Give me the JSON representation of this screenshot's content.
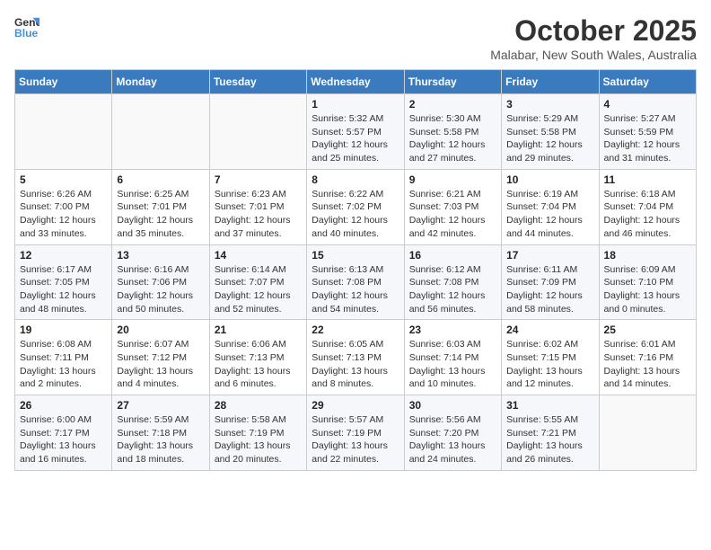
{
  "header": {
    "logo_line1": "General",
    "logo_line2": "Blue",
    "month": "October 2025",
    "location": "Malabar, New South Wales, Australia"
  },
  "weekdays": [
    "Sunday",
    "Monday",
    "Tuesday",
    "Wednesday",
    "Thursday",
    "Friday",
    "Saturday"
  ],
  "weeks": [
    [
      {
        "day": "",
        "text": ""
      },
      {
        "day": "",
        "text": ""
      },
      {
        "day": "",
        "text": ""
      },
      {
        "day": "1",
        "text": "Sunrise: 5:32 AM\nSunset: 5:57 PM\nDaylight: 12 hours\nand 25 minutes."
      },
      {
        "day": "2",
        "text": "Sunrise: 5:30 AM\nSunset: 5:58 PM\nDaylight: 12 hours\nand 27 minutes."
      },
      {
        "day": "3",
        "text": "Sunrise: 5:29 AM\nSunset: 5:58 PM\nDaylight: 12 hours\nand 29 minutes."
      },
      {
        "day": "4",
        "text": "Sunrise: 5:27 AM\nSunset: 5:59 PM\nDaylight: 12 hours\nand 31 minutes."
      }
    ],
    [
      {
        "day": "5",
        "text": "Sunrise: 6:26 AM\nSunset: 7:00 PM\nDaylight: 12 hours\nand 33 minutes."
      },
      {
        "day": "6",
        "text": "Sunrise: 6:25 AM\nSunset: 7:01 PM\nDaylight: 12 hours\nand 35 minutes."
      },
      {
        "day": "7",
        "text": "Sunrise: 6:23 AM\nSunset: 7:01 PM\nDaylight: 12 hours\nand 37 minutes."
      },
      {
        "day": "8",
        "text": "Sunrise: 6:22 AM\nSunset: 7:02 PM\nDaylight: 12 hours\nand 40 minutes."
      },
      {
        "day": "9",
        "text": "Sunrise: 6:21 AM\nSunset: 7:03 PM\nDaylight: 12 hours\nand 42 minutes."
      },
      {
        "day": "10",
        "text": "Sunrise: 6:19 AM\nSunset: 7:04 PM\nDaylight: 12 hours\nand 44 minutes."
      },
      {
        "day": "11",
        "text": "Sunrise: 6:18 AM\nSunset: 7:04 PM\nDaylight: 12 hours\nand 46 minutes."
      }
    ],
    [
      {
        "day": "12",
        "text": "Sunrise: 6:17 AM\nSunset: 7:05 PM\nDaylight: 12 hours\nand 48 minutes."
      },
      {
        "day": "13",
        "text": "Sunrise: 6:16 AM\nSunset: 7:06 PM\nDaylight: 12 hours\nand 50 minutes."
      },
      {
        "day": "14",
        "text": "Sunrise: 6:14 AM\nSunset: 7:07 PM\nDaylight: 12 hours\nand 52 minutes."
      },
      {
        "day": "15",
        "text": "Sunrise: 6:13 AM\nSunset: 7:08 PM\nDaylight: 12 hours\nand 54 minutes."
      },
      {
        "day": "16",
        "text": "Sunrise: 6:12 AM\nSunset: 7:08 PM\nDaylight: 12 hours\nand 56 minutes."
      },
      {
        "day": "17",
        "text": "Sunrise: 6:11 AM\nSunset: 7:09 PM\nDaylight: 12 hours\nand 58 minutes."
      },
      {
        "day": "18",
        "text": "Sunrise: 6:09 AM\nSunset: 7:10 PM\nDaylight: 13 hours\nand 0 minutes."
      }
    ],
    [
      {
        "day": "19",
        "text": "Sunrise: 6:08 AM\nSunset: 7:11 PM\nDaylight: 13 hours\nand 2 minutes."
      },
      {
        "day": "20",
        "text": "Sunrise: 6:07 AM\nSunset: 7:12 PM\nDaylight: 13 hours\nand 4 minutes."
      },
      {
        "day": "21",
        "text": "Sunrise: 6:06 AM\nSunset: 7:13 PM\nDaylight: 13 hours\nand 6 minutes."
      },
      {
        "day": "22",
        "text": "Sunrise: 6:05 AM\nSunset: 7:13 PM\nDaylight: 13 hours\nand 8 minutes."
      },
      {
        "day": "23",
        "text": "Sunrise: 6:03 AM\nSunset: 7:14 PM\nDaylight: 13 hours\nand 10 minutes."
      },
      {
        "day": "24",
        "text": "Sunrise: 6:02 AM\nSunset: 7:15 PM\nDaylight: 13 hours\nand 12 minutes."
      },
      {
        "day": "25",
        "text": "Sunrise: 6:01 AM\nSunset: 7:16 PM\nDaylight: 13 hours\nand 14 minutes."
      }
    ],
    [
      {
        "day": "26",
        "text": "Sunrise: 6:00 AM\nSunset: 7:17 PM\nDaylight: 13 hours\nand 16 minutes."
      },
      {
        "day": "27",
        "text": "Sunrise: 5:59 AM\nSunset: 7:18 PM\nDaylight: 13 hours\nand 18 minutes."
      },
      {
        "day": "28",
        "text": "Sunrise: 5:58 AM\nSunset: 7:19 PM\nDaylight: 13 hours\nand 20 minutes."
      },
      {
        "day": "29",
        "text": "Sunrise: 5:57 AM\nSunset: 7:19 PM\nDaylight: 13 hours\nand 22 minutes."
      },
      {
        "day": "30",
        "text": "Sunrise: 5:56 AM\nSunset: 7:20 PM\nDaylight: 13 hours\nand 24 minutes."
      },
      {
        "day": "31",
        "text": "Sunrise: 5:55 AM\nSunset: 7:21 PM\nDaylight: 13 hours\nand 26 minutes."
      },
      {
        "day": "",
        "text": ""
      }
    ]
  ]
}
